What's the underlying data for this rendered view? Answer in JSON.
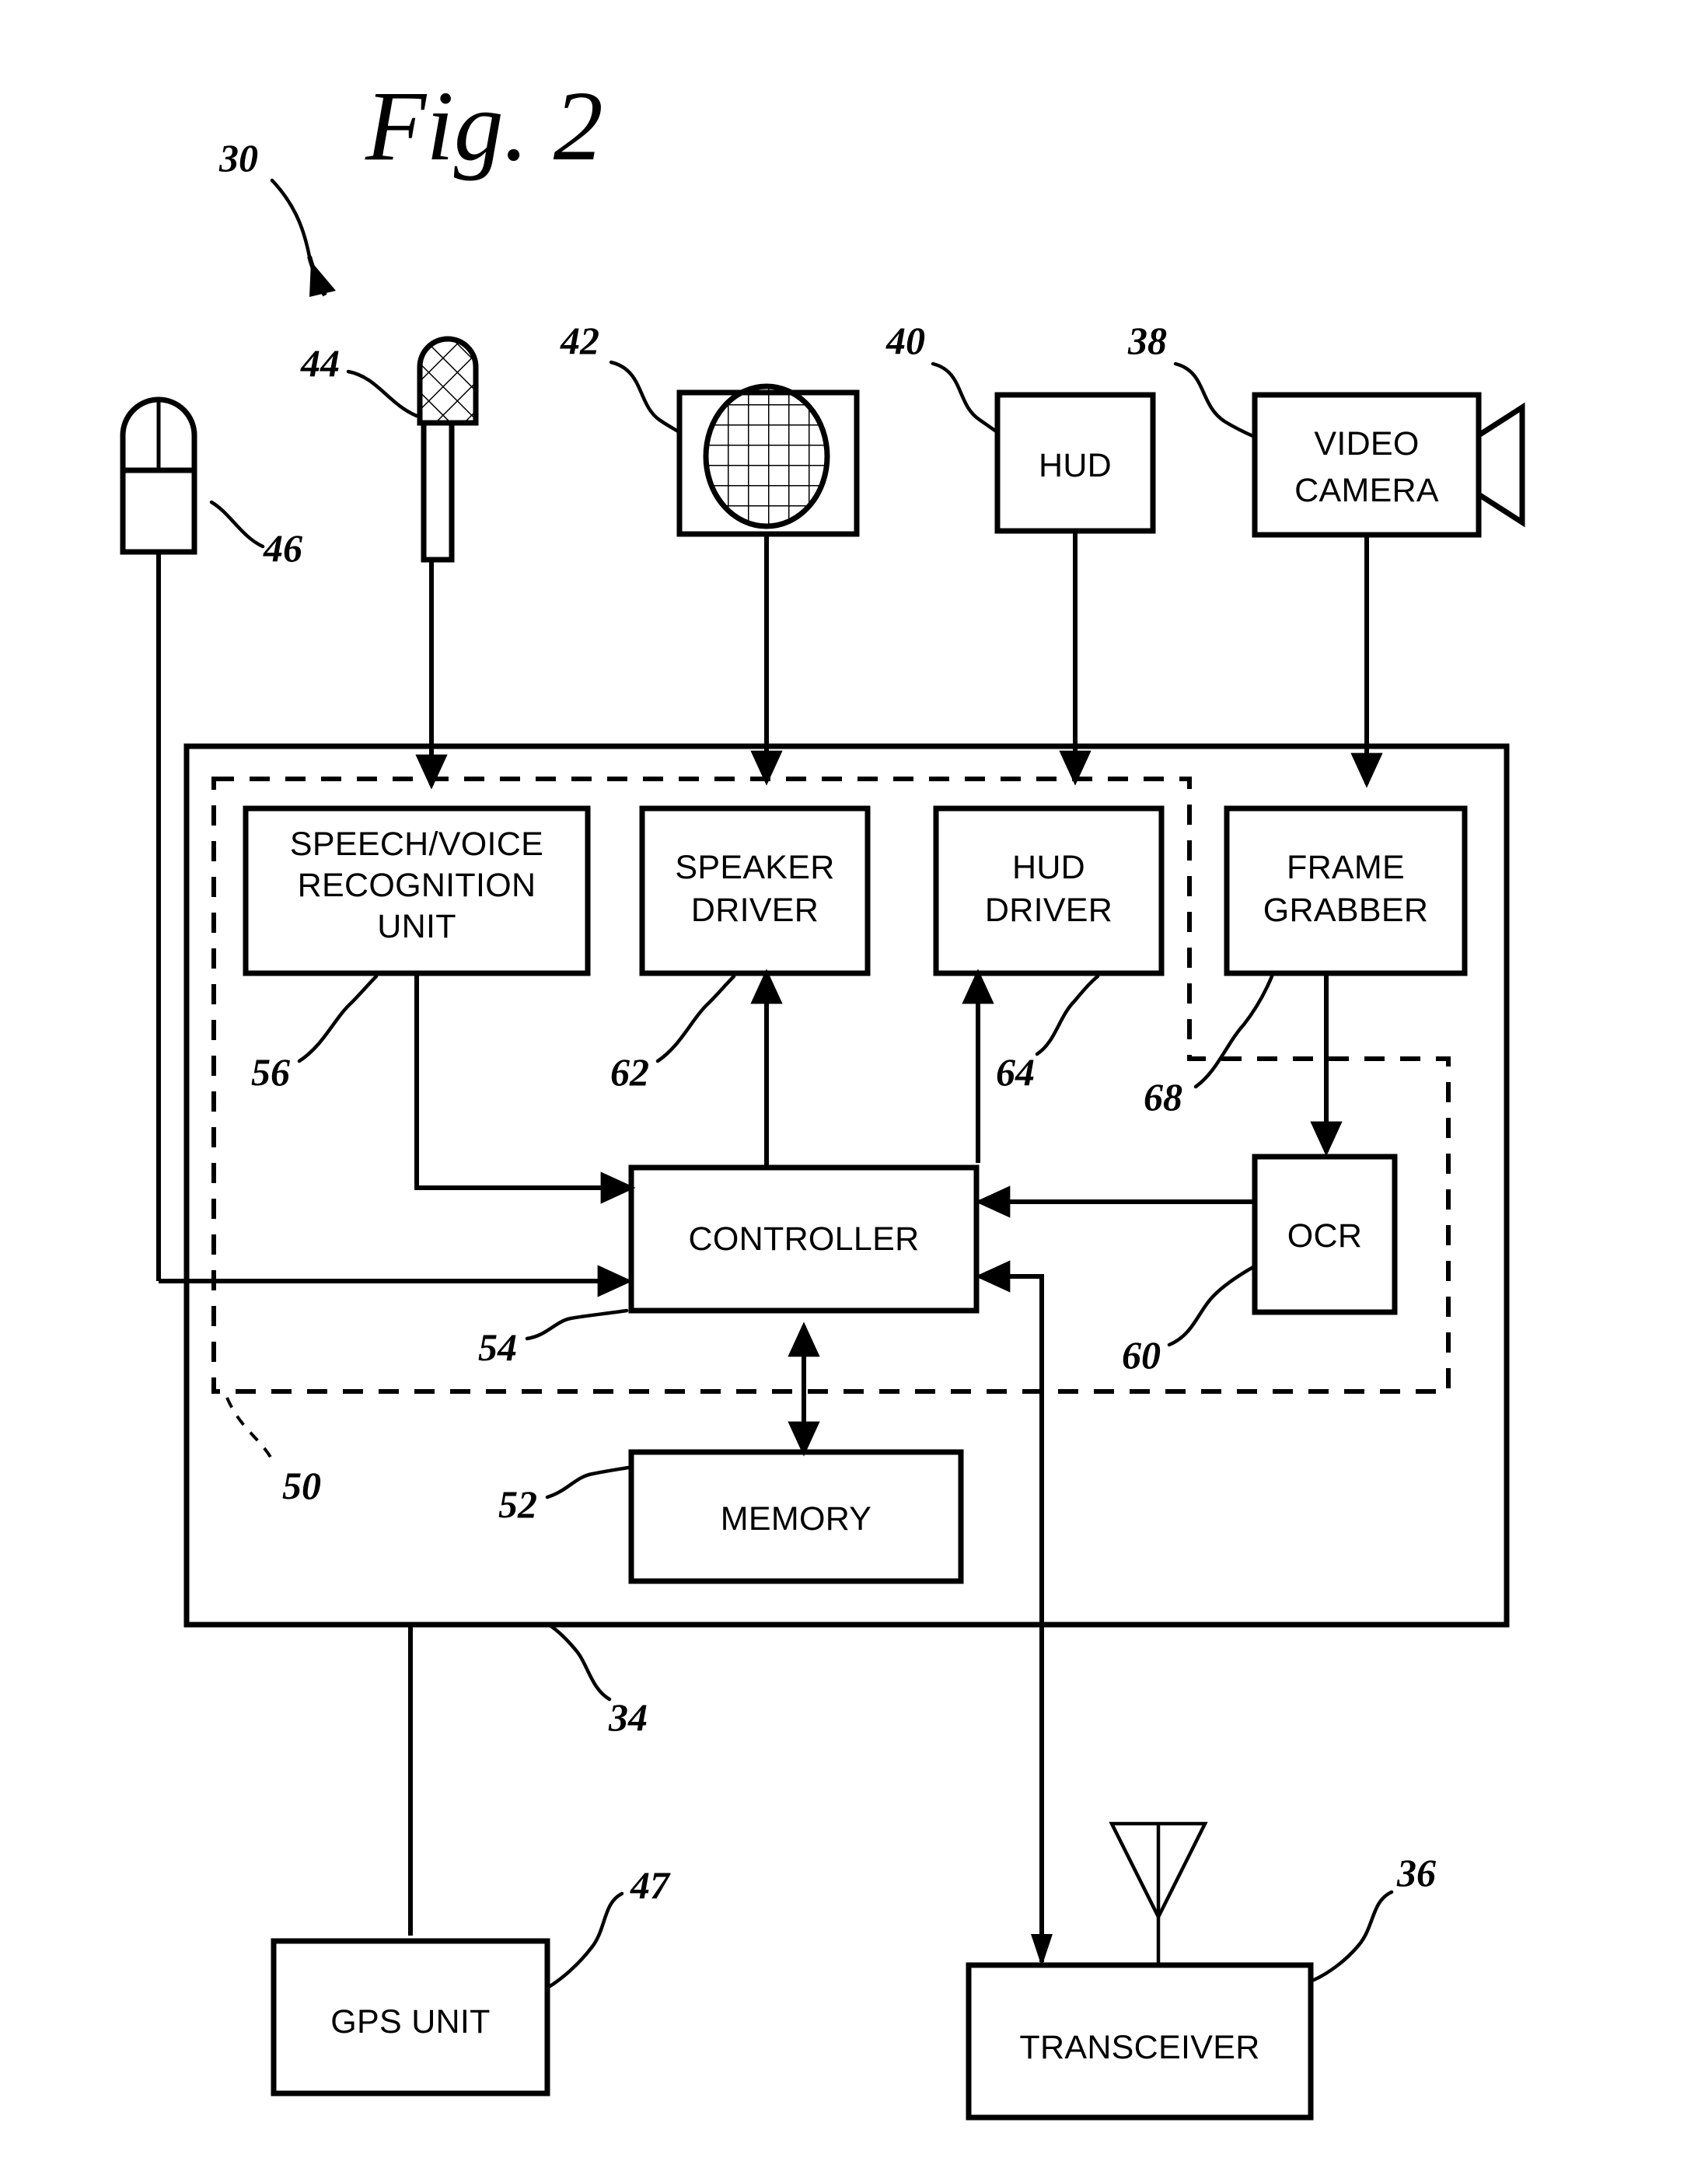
{
  "figure": {
    "title": "Fig. 2",
    "system_ref": "30"
  },
  "external_devices": [
    {
      "id": "pointing-device",
      "ref": "46",
      "label": "",
      "icon": "mouse-icon"
    },
    {
      "id": "microphone",
      "ref": "44",
      "label": "",
      "icon": "microphone-icon"
    },
    {
      "id": "speaker",
      "ref": "42",
      "label": "",
      "icon": "speaker-grille-icon"
    },
    {
      "id": "hud",
      "ref": "40",
      "label": "HUD",
      "icon": "display-box-icon"
    },
    {
      "id": "video-camera",
      "ref": "38",
      "label": "VIDEO CAMERA",
      "icon": "video-camera-icon"
    }
  ],
  "main_unit": {
    "ref": "34",
    "inner_dashed_ref": "50",
    "blocks": [
      {
        "id": "speech-voice-recognition-unit",
        "ref": "56",
        "lines": [
          "SPEECH/VOICE",
          "RECOGNITION",
          "UNIT"
        ]
      },
      {
        "id": "speaker-driver",
        "ref": "62",
        "lines": [
          "SPEAKER",
          "DRIVER"
        ]
      },
      {
        "id": "hud-driver",
        "ref": "64",
        "lines": [
          "HUD",
          "DRIVER"
        ]
      },
      {
        "id": "frame-grabber",
        "ref": "68",
        "lines": [
          "FRAME",
          "GRABBER"
        ]
      },
      {
        "id": "controller",
        "ref": "54",
        "lines": [
          "CONTROLLER"
        ]
      },
      {
        "id": "ocr",
        "ref": "60",
        "lines": [
          "OCR"
        ]
      },
      {
        "id": "memory",
        "ref": "52",
        "lines": [
          "MEMORY"
        ]
      }
    ]
  },
  "peripherals": [
    {
      "id": "gps-unit",
      "ref": "47",
      "label": "GPS UNIT"
    },
    {
      "id": "transceiver",
      "ref": "36",
      "label": "TRANSCEIVER",
      "icon": "antenna-icon"
    }
  ],
  "labels": {
    "speech_l1": "SPEECH/VOICE",
    "speech_l2": "RECOGNITION",
    "speech_l3": "UNIT",
    "speaker_l1": "SPEAKER",
    "speaker_l2": "DRIVER",
    "huddrv_l1": "HUD",
    "huddrv_l2": "DRIVER",
    "frame_l1": "FRAME",
    "frame_l2": "GRABBER",
    "controller": "CONTROLLER",
    "ocr": "OCR",
    "memory": "MEMORY",
    "hud": "HUD",
    "camera_l1": "VIDEO",
    "camera_l2": "CAMERA",
    "gps": "GPS UNIT",
    "transceiver": "TRANSCEIVER",
    "fig": "Fig. 2"
  },
  "refs": {
    "r30": "30",
    "r34": "34",
    "r36": "36",
    "r38": "38",
    "r40": "40",
    "r42": "42",
    "r44": "44",
    "r46": "46",
    "r47": "47",
    "r50": "50",
    "r52": "52",
    "r54": "54",
    "r56": "56",
    "r60": "60",
    "r62": "62",
    "r64": "64",
    "r68": "68"
  },
  "colors": {
    "ink": "#000000",
    "paper": "#ffffff"
  }
}
